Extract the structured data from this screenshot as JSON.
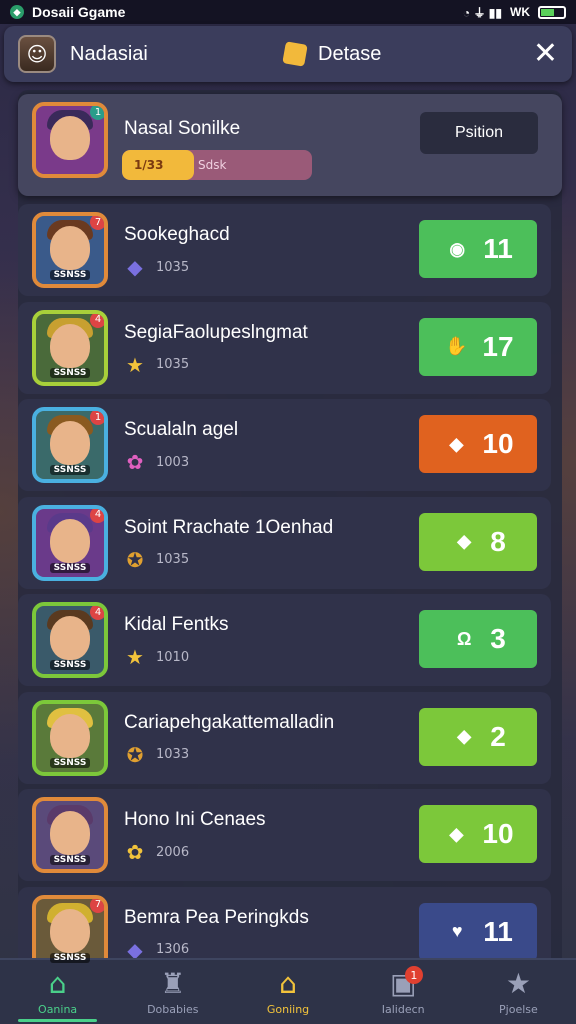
{
  "status_bar": {
    "title": "Dosaii Ggame",
    "signal": "◔ ⏚ ▮▮",
    "wifi": "WK"
  },
  "header": {
    "username": "Nadasiai",
    "currency_label": "Detase",
    "close": "✕"
  },
  "player": {
    "name": "Nasal Sonilke",
    "progress_value": "1/33",
    "progress_label": "Sdsk",
    "progress_fraction": 0.38,
    "position_label": "Psition"
  },
  "rows": [
    {
      "name": "Sookeghacd",
      "sub": "1035",
      "gem_icon": "cube-icon",
      "gem_glyph": "◆",
      "gem_color": "#7a70e0",
      "score": "11",
      "score_color": "#4cbf5a",
      "score_icon": "orb-icon",
      "score_glyph": "◉",
      "portrait_border": "#e08a3a",
      "portrait_bg": "#3a5a8a",
      "hair": "#6a3a20",
      "tag": "SSNSS",
      "badge": "7"
    },
    {
      "name": "SegiaFaolupeslngmat",
      "sub": "1035",
      "gem_icon": "star-icon",
      "gem_glyph": "★",
      "gem_color": "#f2c33b",
      "score": "17",
      "score_color": "#4cbf5a",
      "score_icon": "hand-icon",
      "score_glyph": "✋",
      "portrait_border": "#a8d03a",
      "portrait_bg": "#4a6a3a",
      "hair": "#c8a030",
      "tag": "SSNSS",
      "badge": "4"
    },
    {
      "name": "Scualaln agel",
      "sub": "1003",
      "gem_icon": "flower-icon",
      "gem_glyph": "✿",
      "gem_color": "#e060c0",
      "score": "10",
      "score_color": "#e0621f",
      "score_icon": "gem-icon",
      "score_glyph": "◆",
      "portrait_border": "#4ab0e0",
      "portrait_bg": "#3a6a6a",
      "hair": "#8a5a20",
      "tag": "SSNSS",
      "badge": "1"
    },
    {
      "name": "Soint Rrachate 1Oenhad",
      "sub": "1035",
      "gem_icon": "star-icon",
      "gem_glyph": "✪",
      "gem_color": "#e0a030",
      "score": "8",
      "score_color": "#7cc83a",
      "score_icon": "cube-icon",
      "score_glyph": "◆",
      "portrait_border": "#4ab0e0",
      "portrait_bg": "#6a3a8a",
      "hair": "#5a3a8a",
      "tag": "SSNSS",
      "badge": "4"
    },
    {
      "name": "Kidal Fentks",
      "sub": "1010",
      "gem_icon": "star-icon",
      "gem_glyph": "★",
      "gem_color": "#f2c33b",
      "score": "3",
      "score_color": "#4cbf5a",
      "score_icon": "horseshoe-icon",
      "score_glyph": "Ω",
      "portrait_border": "#7cc83a",
      "portrait_bg": "#3a5a6a",
      "hair": "#5a3a20",
      "tag": "SSNSS",
      "badge": "4"
    },
    {
      "name": "Cariapehgakattemalladin",
      "sub": "1033",
      "gem_icon": "star-icon",
      "gem_glyph": "✪",
      "gem_color": "#e0a030",
      "score": "2",
      "score_color": "#7cc83a",
      "score_icon": "cube-icon",
      "score_glyph": "◆",
      "portrait_border": "#7cc83a",
      "portrait_bg": "#5a7a3a",
      "hair": "#e0c040",
      "tag": "SSNSS",
      "badge": ""
    },
    {
      "name": "Hono Ini Cenaes",
      "sub": "2006",
      "gem_icon": "flower-icon",
      "gem_glyph": "✿",
      "gem_color": "#f2c33b",
      "score": "10",
      "score_color": "#7cc83a",
      "score_icon": "gem-icon",
      "score_glyph": "◆",
      "portrait_border": "#e08a3a",
      "portrait_bg": "#5a4a7a",
      "hair": "#5a3a6a",
      "tag": "SSNSS",
      "badge": ""
    },
    {
      "name": "Bemra Pea Peringkds",
      "sub": "1306",
      "gem_icon": "cube-icon",
      "gem_glyph": "◆",
      "gem_color": "#7a70e0",
      "score": "11",
      "score_color": "#3a4a8a",
      "score_icon": "heart-icon",
      "score_glyph": "♥",
      "portrait_border": "#e08a3a",
      "portrait_bg": "#6a5a3a",
      "hair": "#d0b030",
      "tag": "SSNSS",
      "badge": "7"
    }
  ],
  "tabs": [
    {
      "label": "Oanina",
      "icon": "home-icon",
      "glyph": "⌂"
    },
    {
      "label": "Dobabies",
      "icon": "trophy-icon",
      "glyph": "♜"
    },
    {
      "label": "Goniing",
      "icon": "home-icon",
      "glyph": "⌂"
    },
    {
      "label": "Ialidecn",
      "icon": "inbox-icon",
      "glyph": "▣",
      "badge": "1"
    },
    {
      "label": "Pjoelse",
      "icon": "star-icon",
      "glyph": "★"
    }
  ]
}
